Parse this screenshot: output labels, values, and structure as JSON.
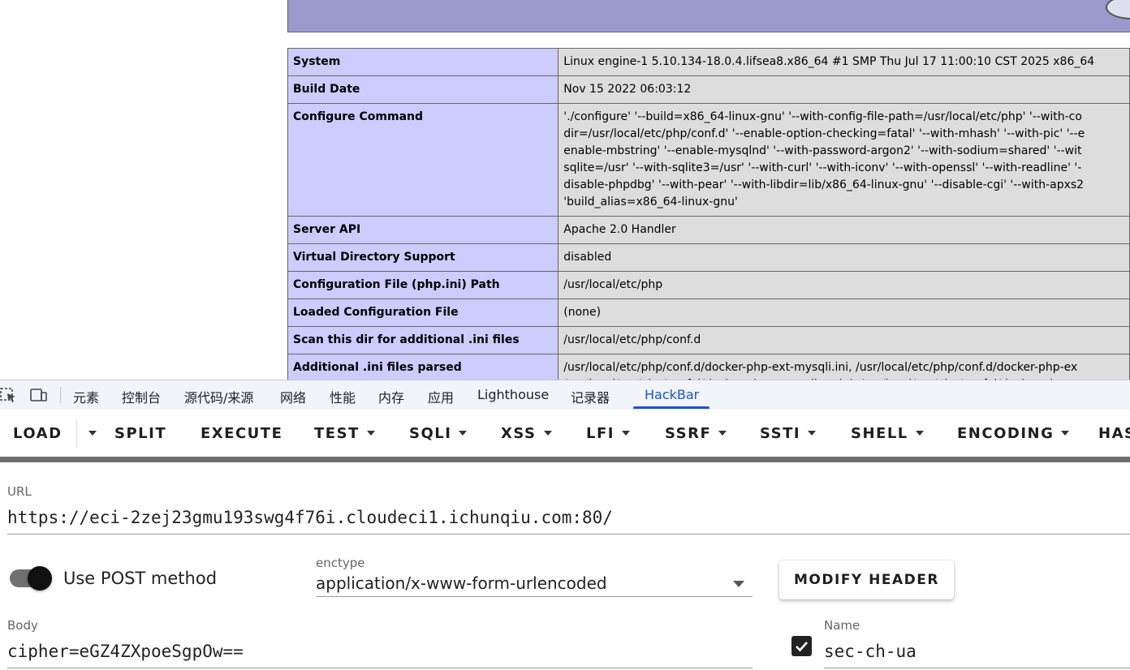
{
  "phpinfo": {
    "rows": [
      {
        "label": "System",
        "lines": [
          "Linux engine-1 5.10.134-18.0.4.lifsea8.x86_64 #1 SMP Thu Jul 17 11:00:10 CST 2025 x86_64"
        ]
      },
      {
        "label": "Build Date",
        "lines": [
          "Nov 15 2022 06:03:12"
        ]
      },
      {
        "label": "Configure Command",
        "lines": [
          "'./configure' '--build=x86_64-linux-gnu' '--with-config-file-path=/usr/local/etc/php' '--with-co",
          "dir=/usr/local/etc/php/conf.d' '--enable-option-checking=fatal' '--with-mhash' '--with-pic' '--e",
          "enable-mbstring' '--enable-mysqlnd' '--with-password-argon2' '--with-sodium=shared' '--wit",
          "sqlite=/usr' '--with-sqlite3=/usr' '--with-curl' '--with-iconv' '--with-openssl' '--with-readline' '-",
          "disable-phpdbg' '--with-pear' '--with-libdir=lib/x86_64-linux-gnu' '--disable-cgi' '--with-apxs2",
          "'build_alias=x86_64-linux-gnu'"
        ]
      },
      {
        "label": "Server API",
        "lines": [
          "Apache 2.0 Handler"
        ]
      },
      {
        "label": "Virtual Directory Support",
        "lines": [
          "disabled"
        ]
      },
      {
        "label": "Configuration File (php.ini) Path",
        "lines": [
          "/usr/local/etc/php"
        ]
      },
      {
        "label": "Loaded Configuration File",
        "lines": [
          "(none)"
        ]
      },
      {
        "label": "Scan this dir for additional .ini files",
        "lines": [
          "/usr/local/etc/php/conf.d"
        ]
      },
      {
        "label": "Additional .ini files parsed",
        "lines": [
          "/usr/local/etc/php/conf.d/docker-php-ext-mysqli.ini, /usr/local/etc/php/conf.d/docker-php-ex",
          "/usr/local/etc/php/conf.d/docker-php-ext-sodium.ini, /usr/local/etc/php/conf.d/docker-php-e"
        ]
      }
    ]
  },
  "devtools": {
    "icons": [
      "inspect-element-icon",
      "device-toolbar-icon"
    ],
    "tabs": [
      "元素",
      "控制台",
      "源代码/来源",
      "网络",
      "性能",
      "内存",
      "应用",
      "Lighthouse",
      "记录器",
      "HackBar"
    ],
    "active_tab": "HackBar"
  },
  "hackbar": {
    "toolbar": {
      "load": "LOAD",
      "split": "SPLIT",
      "execute": "EXECUTE",
      "test": "TEST",
      "sqli": "SQLI",
      "xss": "XSS",
      "lfi": "LFI",
      "ssrf": "SSRF",
      "ssti": "SSTI",
      "shell": "SHELL",
      "encoding": "ENCODING",
      "hashing": "HAS"
    },
    "url_label": "URL",
    "url_value": "https://eci-2zej23gmu193swg4f76i.cloudeci1.ichunqiu.com:80/",
    "post_label": "Use POST method",
    "post_enabled": true,
    "enctype_label": "enctype",
    "enctype_value": "application/x-www-form-urlencoded",
    "modify_header": "MODIFY HEADER",
    "body_label": "Body",
    "body_value": "cipher=eGZ4ZXpoeSgpOw==",
    "header": {
      "enabled": true,
      "name_label": "Name",
      "name_value": "sec-ch-ua"
    }
  },
  "colors": {
    "php_header": "#9999cc",
    "php_label_bg": "#ccccff",
    "php_value_bg": "#dddddd",
    "accent": "#1a56c9"
  }
}
